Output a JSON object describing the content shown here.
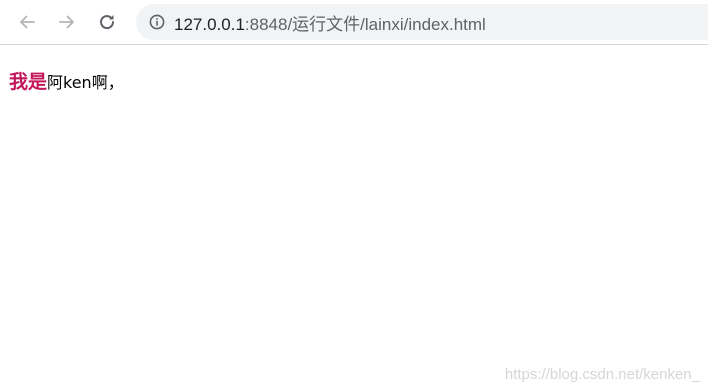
{
  "toolbar": {
    "back_icon": "arrow-left-icon",
    "forward_icon": "arrow-right-icon",
    "reload_icon": "reload-icon",
    "info_icon": "info-circle-icon",
    "url_host": "127.0.0.1",
    "url_path": ":8848/运行文件/lainxi/index.html"
  },
  "page": {
    "emphasis": "我是",
    "rest": "阿ken啊，",
    "emphasis_color": "#c2185b"
  },
  "watermark": "https://blog.csdn.net/kenken_"
}
